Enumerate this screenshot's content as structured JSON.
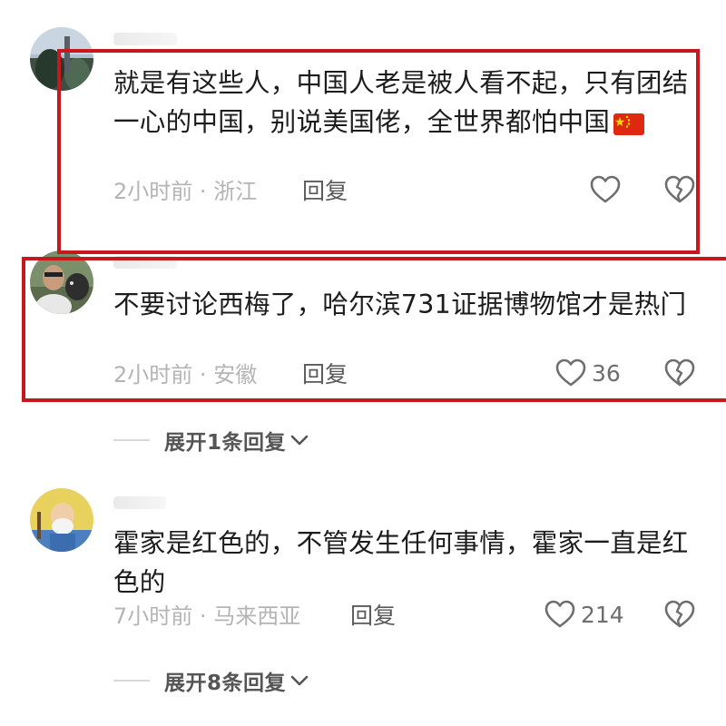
{
  "comments": [
    {
      "username": "用户",
      "text": "就是有这些人，中国人老是被人看不起，只有团结一心的中国，别说美国佬，全世界都怕中国",
      "time": "2小时前",
      "separator": "·",
      "location": "浙江",
      "reply_label": "回复",
      "likes": "",
      "flag_icon": "china-flag-emoji"
    },
    {
      "username": "用户",
      "text": "不要讨论西梅了，哈尔滨731证据博物馆才是热门",
      "time": "2小时前",
      "separator": "·",
      "location": "安徽",
      "reply_label": "回复",
      "likes": "36",
      "expand_label": "展开1条回复"
    },
    {
      "username": "用户",
      "text": "霍家是红色的，不管发生任何事情，霍家一直是红色的",
      "time": "7小时前",
      "separator": "·",
      "location": "马来西亚",
      "reply_label": "回复",
      "likes": "214",
      "expand_label": "展开8条回复"
    }
  ],
  "colors": {
    "highlight_border": "#c8181e",
    "meta_text": "#b4b4b4",
    "body_text": "#1c1c1c",
    "icon_stroke": "#6e6e6e"
  },
  "icons": {
    "like": "heart-outline-icon",
    "dislike": "broken-heart-icon",
    "expand": "chevron-down-icon"
  }
}
